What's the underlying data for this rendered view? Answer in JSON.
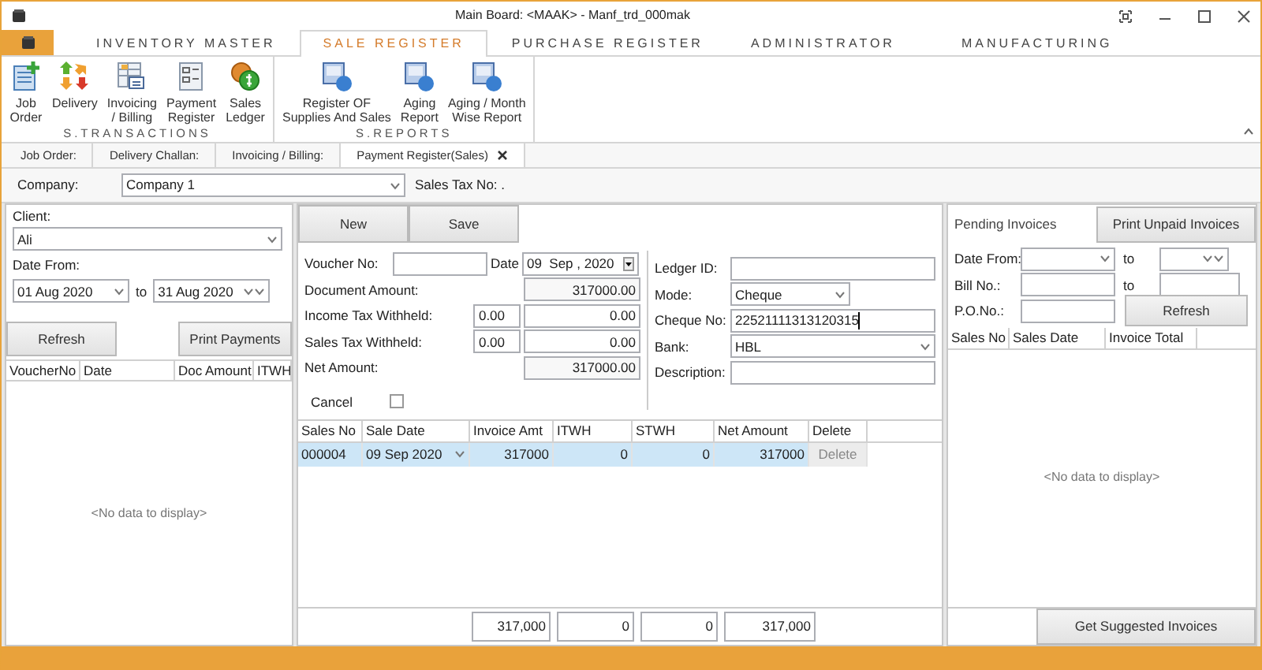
{
  "window": {
    "title": "Main Board: <MAAK> - Manf_trd_000mak"
  },
  "ribbon": {
    "tabs": [
      {
        "label": "INVENTORY MASTER",
        "selected": false
      },
      {
        "label": "SALE REGISTER",
        "selected": true
      },
      {
        "label": "PURCHASE REGISTER",
        "selected": false
      },
      {
        "label": "ADMINISTRATOR",
        "selected": false
      },
      {
        "label": "MANUFACTURING",
        "selected": false
      }
    ],
    "groups": [
      {
        "label": "S.TRANSACTIONS",
        "items": [
          {
            "kind": "add-doc",
            "lines": [
              "Job",
              "Order"
            ]
          },
          {
            "kind": "arrows",
            "lines": [
              "Delivery"
            ]
          },
          {
            "kind": "table",
            "lines": [
              "Invoicing",
              "/ Billing"
            ]
          },
          {
            "kind": "checklist",
            "lines": [
              "Payment",
              "Register"
            ]
          },
          {
            "kind": "coins",
            "lines": [
              "Sales",
              "Ledger"
            ]
          }
        ]
      },
      {
        "label": "S.REPORTS",
        "items": [
          {
            "kind": "report",
            "lines": [
              "Register OF",
              "Supplies And Sales"
            ]
          },
          {
            "kind": "report",
            "lines": [
              "Aging",
              "Report"
            ]
          },
          {
            "kind": "report",
            "lines": [
              "Aging / Month",
              "Wise Report"
            ]
          }
        ]
      }
    ]
  },
  "doc_tabs": [
    {
      "label": "Job Order:",
      "selected": false
    },
    {
      "label": "Delivery Challan:",
      "selected": false
    },
    {
      "label": "Invoicing / Billing:",
      "selected": false
    },
    {
      "label": "Payment Register(Sales)",
      "selected": true
    }
  ],
  "company": {
    "label": "Company:",
    "value": "Company 1",
    "sales_tax_label": "Sales Tax No: ."
  },
  "left": {
    "client_label": "Client:",
    "client": "Ali",
    "date_from_label": "Date From:",
    "date_from": "01 Aug 2020",
    "to_label": "to",
    "date_to": "31 Aug 2020",
    "buttons": [
      "Refresh",
      "Print Payments"
    ],
    "columns": [
      "VoucherNo",
      "Date",
      "Doc Amount",
      "ITWH"
    ],
    "empty_text": "<No data to display>"
  },
  "voucher": {
    "buttons": [
      "New",
      "Save"
    ],
    "voucher_no_label": "Voucher No:",
    "date_label": "Date",
    "date": "09  Sep , 2020",
    "amounts": [
      {
        "label": "Document Amount:",
        "value": "317000.00"
      },
      {
        "label": "Income Tax Withheld:",
        "rate": "0.00",
        "value": "0.00"
      },
      {
        "label": "Sales Tax Withheld:",
        "rate": "0.00",
        "value": "0.00"
      },
      {
        "label": "Net Amount:",
        "value": "317000.00"
      }
    ],
    "right_fields": [
      {
        "label": "Ledger ID:",
        "kind": "text"
      },
      {
        "label": "Mode:",
        "kind": "short-combo",
        "value": "Cheque"
      },
      {
        "label": "Cheque No:",
        "kind": "text",
        "value": "22521111313120315"
      },
      {
        "label": "Bank:",
        "kind": "combo",
        "value": "HBL"
      },
      {
        "label": "Description:",
        "kind": "text"
      }
    ],
    "cancel": {
      "label": "Cancel",
      "checked": false
    }
  },
  "grid": {
    "columns": [
      "Sales No",
      "Sale Date",
      "Invoice Amt",
      "ITWH",
      "STWH",
      "Net Amount",
      "Delete"
    ],
    "rows": [
      {
        "selected": true,
        "cells": [
          "000004",
          "09 Sep 2020",
          "317000",
          "0",
          "0",
          "317000"
        ],
        "action": "Delete"
      }
    ],
    "totals": [
      "317,000",
      "0",
      "0",
      "317,000"
    ]
  },
  "pending": {
    "title": "Pending Invoices",
    "print_button": "Print Unpaid Invoices",
    "date_from_label": "Date From:",
    "to_label": "to",
    "bill_no_label": "Bill No.:",
    "bill_to_label": "to",
    "po_label": "P.O.No.:",
    "refresh": "Refresh",
    "columns": [
      "Sales No",
      "Sales Date",
      "Invoice Total"
    ],
    "empty_text": "<No data to display>",
    "suggest_button": "Get Suggested Invoices"
  }
}
